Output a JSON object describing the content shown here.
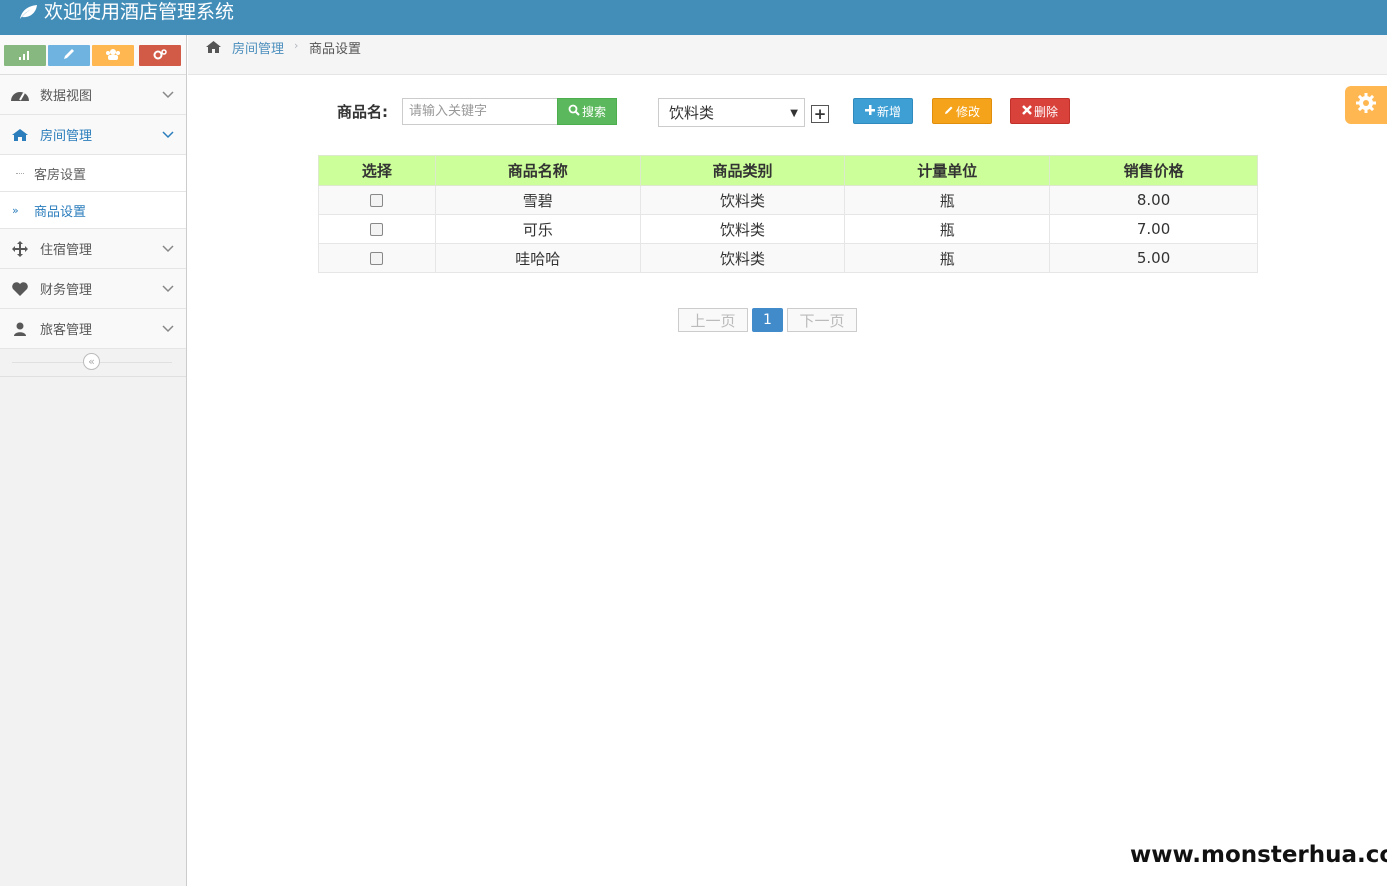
{
  "app": {
    "title": "欢迎使用酒店管理系统",
    "accent": "#438eb9"
  },
  "sidebar": {
    "items": [
      {
        "label": "数据视图",
        "icon": "tachometer-icon"
      },
      {
        "label": "房间管理",
        "icon": "home-icon",
        "active": true
      },
      {
        "label": "住宿管理",
        "icon": "move-arrows-icon"
      },
      {
        "label": "财务管理",
        "icon": "heart-icon"
      },
      {
        "label": "旅客管理",
        "icon": "user-icon"
      }
    ],
    "subitems": [
      {
        "label": "客房设置"
      },
      {
        "label": "商品设置",
        "active": true
      }
    ],
    "collapse_glyph": "«"
  },
  "breadcrumb": {
    "parent": "房间管理",
    "separator": "›",
    "current": "商品设置"
  },
  "toolbar": {
    "search_label": "商品名:",
    "search_placeholder": "请输入关键字",
    "search_button": "搜索",
    "category_selected": "饮料类",
    "add_button": "新增",
    "edit_button": "修改",
    "delete_button": "删除",
    "plus_glyph": "+"
  },
  "table": {
    "headers": [
      "选择",
      "商品名称",
      "商品类别",
      "计量单位",
      "销售价格"
    ],
    "rows": [
      {
        "name": "雪碧",
        "category": "饮料类",
        "unit": "瓶",
        "price": "8.00"
      },
      {
        "name": "可乐",
        "category": "饮料类",
        "unit": "瓶",
        "price": "7.00"
      },
      {
        "name": "哇哈哈",
        "category": "饮料类",
        "unit": "瓶",
        "price": "5.00"
      }
    ]
  },
  "pagination": {
    "prev": "上一页",
    "current": "1",
    "next": "下一页"
  },
  "watermark": "www.monsterhua.com"
}
